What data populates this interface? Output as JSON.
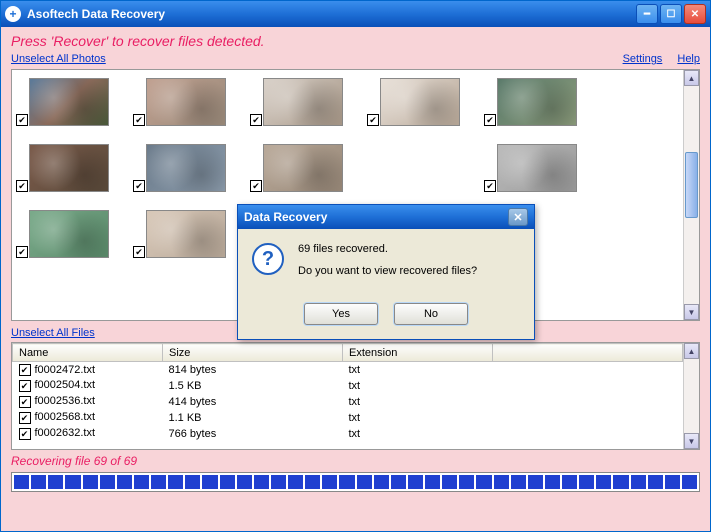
{
  "titlebar": {
    "title": "Asoftech Data Recovery"
  },
  "hint": "Press 'Recover' to recover files detected.",
  "links": {
    "unselect_photos": "Unselect All Photos",
    "settings": "Settings",
    "help": "Help",
    "unselect_files": "Unselect All Files"
  },
  "files": {
    "columns": {
      "name": "Name",
      "size": "Size",
      "ext": "Extension"
    },
    "rows": [
      {
        "name": "f0002472.txt",
        "size": "814 bytes",
        "ext": "txt"
      },
      {
        "name": "f0002504.txt",
        "size": "1.5 KB",
        "ext": "txt"
      },
      {
        "name": "f0002536.txt",
        "size": "414 bytes",
        "ext": "txt"
      },
      {
        "name": "f0002568.txt",
        "size": "1.1 KB",
        "ext": "txt"
      },
      {
        "name": "f0002632.txt",
        "size": "766 bytes",
        "ext": "txt"
      }
    ]
  },
  "status": "Recovering file 69 of 69",
  "dialog": {
    "title": "Data Recovery",
    "msg1": "69 files recovered.",
    "msg2": "Do you want to view recovered files?",
    "yes": "Yes",
    "no": "No"
  }
}
